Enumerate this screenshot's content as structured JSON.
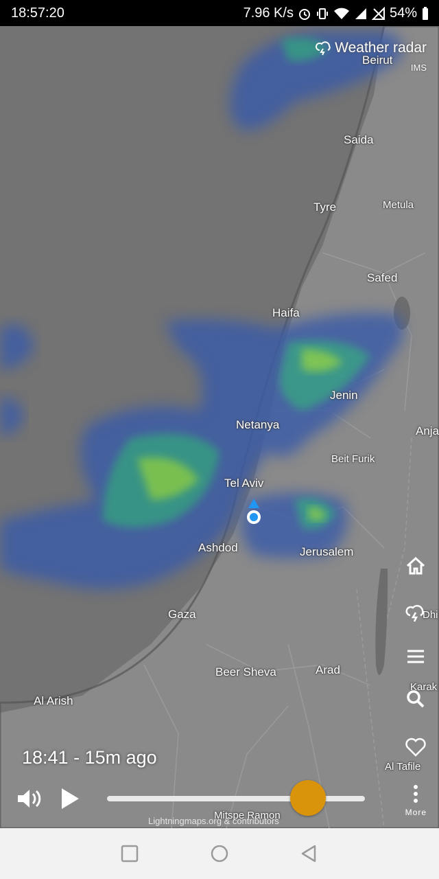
{
  "status_bar": {
    "time": "18:57:20",
    "speed": "7.96 K/s",
    "battery": "54%",
    "icons": [
      "alarm-icon",
      "vibrate-icon",
      "wifi-icon",
      "signal-icon",
      "no-sim-icon",
      "battery-icon"
    ]
  },
  "header": {
    "title": "Weather radar",
    "source": "IMS",
    "icon": "lightning-cloud-icon"
  },
  "cities": [
    {
      "name": "Beirut"
    },
    {
      "name": "Saida"
    },
    {
      "name": "Tyre"
    },
    {
      "name": "Metula"
    },
    {
      "name": "Safed"
    },
    {
      "name": "Haifa"
    },
    {
      "name": "Jenin"
    },
    {
      "name": "Netanya"
    },
    {
      "name": "Anja"
    },
    {
      "name": "Beit Furik"
    },
    {
      "name": "Tel Aviv"
    },
    {
      "name": "Ashdod"
    },
    {
      "name": "Jerusalem"
    },
    {
      "name": "Gaza"
    },
    {
      "name": "Dhi"
    },
    {
      "name": "Beer Sheva"
    },
    {
      "name": "Arad"
    },
    {
      "name": "Al Arish"
    },
    {
      "name": "Karak"
    },
    {
      "name": "Al Tafile"
    },
    {
      "name": "Mitspe Ramon"
    }
  ],
  "playback": {
    "timestamp": "18:41 - 15m ago",
    "slider_position": 0.78,
    "attribution": "Lightningmaps.org & contributors"
  },
  "side_menu": {
    "more_label": "More",
    "buttons": [
      "home-icon",
      "lightning-icon",
      "menu-icon",
      "search-icon",
      "heart-icon",
      "more-vert-icon"
    ]
  },
  "nav": [
    "recents-button",
    "home-button",
    "back-button"
  ],
  "colors": {
    "slider_thumb": "#d9940c",
    "radar_low": "#3b5ba8",
    "radar_mid": "#2a9a8a",
    "radar_high": "#7ad04a"
  }
}
